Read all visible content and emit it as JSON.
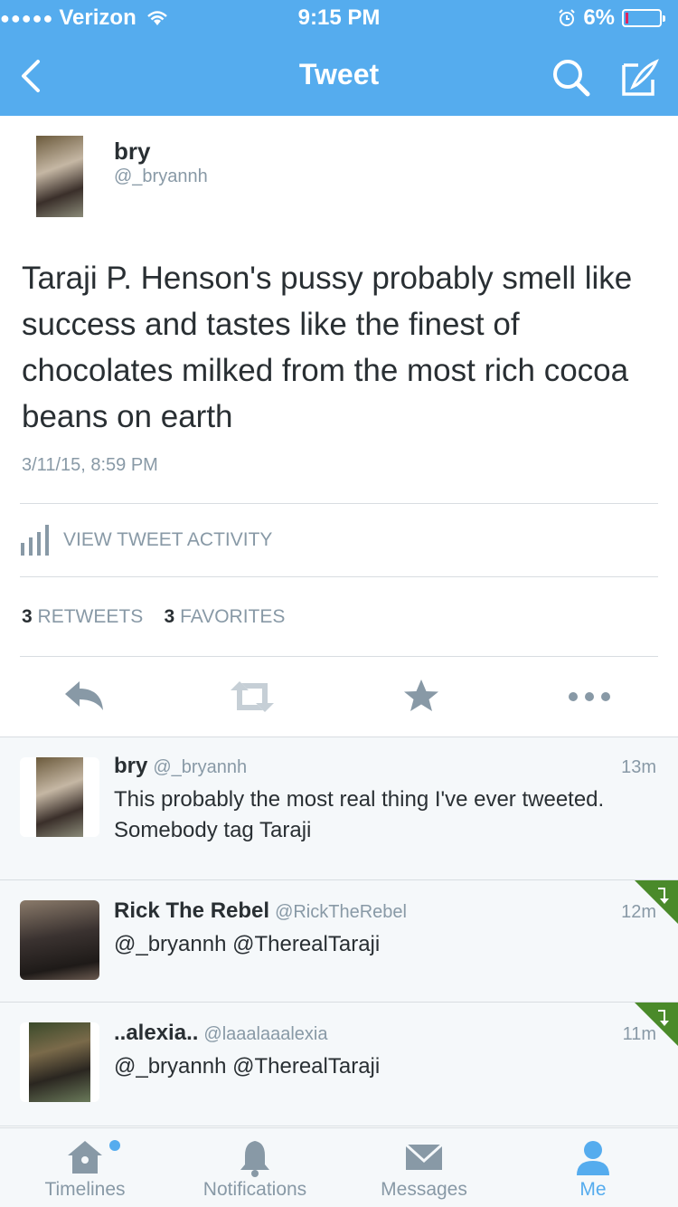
{
  "status_bar": {
    "signal_dots": "●●●●●",
    "carrier": "Verizon",
    "time": "9:15 PM",
    "battery": "6%"
  },
  "nav": {
    "title": "Tweet"
  },
  "tweet": {
    "author_name": "bry",
    "author_handle": "@_bryannh",
    "text": "Taraji P. Henson's pussy probably smell like success and tastes like the finest of chocolates milked from the most rich cocoa beans on earth",
    "timestamp": "3/11/15, 8:59 PM",
    "activity_label": "VIEW TWEET ACTIVITY",
    "retweets_count": "3",
    "retweets_label": "RETWEETS",
    "favorites_count": "3",
    "favorites_label": "FAVORITES"
  },
  "replies": [
    {
      "name": "bry",
      "handle": "@_bryannh",
      "time": "13m",
      "text": "This probably the most real thing I've ever tweeted. Somebody tag Taraji"
    },
    {
      "name": "Rick The Rebel",
      "handle": "@RickTheRebel",
      "time": "12m",
      "text": "@_bryannh @TherealTaraji"
    },
    {
      "name": "..alexia..",
      "handle": "@laaalaaalexia",
      "time": "11m",
      "text": "@_bryannh @TherealTaraji"
    }
  ],
  "tabs": [
    {
      "label": "Timelines",
      "icon": "home-icon"
    },
    {
      "label": "Notifications",
      "icon": "bell-icon"
    },
    {
      "label": "Messages",
      "icon": "envelope-icon"
    },
    {
      "label": "Me",
      "icon": "person-icon",
      "active": true
    }
  ],
  "colors": {
    "brand": "#55acee",
    "text": "#292f33",
    "muted": "#8899a6",
    "conversation_marker": "#4a8a2a"
  }
}
